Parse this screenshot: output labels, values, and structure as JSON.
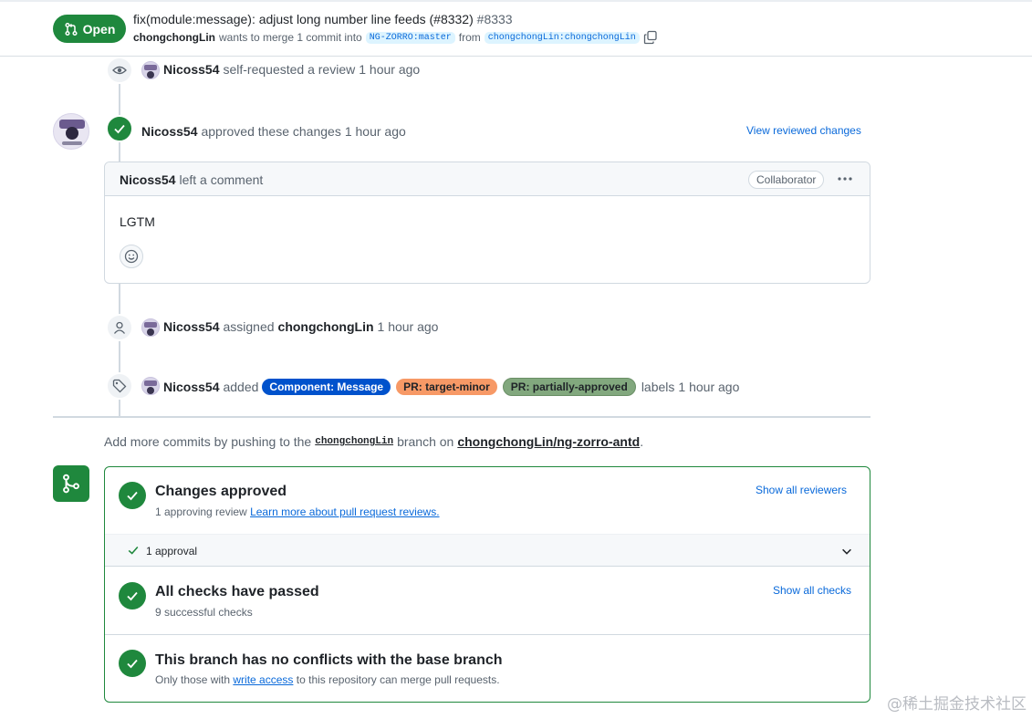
{
  "header": {
    "status": "Open",
    "title": "fix(module:message): adjust long number line feeds (#8332)",
    "number": "#8333",
    "author": "chongchongLin",
    "merge_text": "wants to merge 1 commit into",
    "base_branch": "NG-ZORRO:master",
    "from_text": "from",
    "head_branch": "chongchongLin:chongchongLin"
  },
  "timeline": {
    "event1": {
      "user": "Nicoss54",
      "text": "self-requested a review",
      "time": "1 hour ago"
    },
    "review": {
      "user": "Nicoss54",
      "text": "approved these changes",
      "time": "1 hour ago",
      "link": "View reviewed changes"
    },
    "comment": {
      "user": "Nicoss54",
      "action": "left a comment",
      "role": "Collaborator",
      "body": "LGTM"
    },
    "assign": {
      "user": "Nicoss54",
      "text": "assigned",
      "assignee": "chongchongLin",
      "time": "1 hour ago"
    },
    "labels": {
      "user": "Nicoss54",
      "text": "added",
      "items": [
        {
          "name": "Component: Message",
          "bg": "#0052cc",
          "fg": "#ffffff"
        },
        {
          "name": "PR: target-minor",
          "bg": "#f79966",
          "fg": "#1f2328"
        },
        {
          "name": "PR: partially-approved",
          "bg": "#82a87e",
          "fg": "#1f2328"
        }
      ],
      "suffix": "labels",
      "time": "1 hour ago"
    }
  },
  "push_hint": {
    "prefix": "Add more commits by pushing to the",
    "branch": "chongchongLin",
    "middle": "branch on",
    "repo": "chongchongLin/ng-zorro-antd",
    "end": "."
  },
  "merge": {
    "approved_title": "Changes approved",
    "approved_sub": "1 approving review",
    "learn_link": "Learn more about pull request reviews.",
    "show_reviewers": "Show all reviewers",
    "approval_count": "1 approval",
    "checks_title": "All checks have passed",
    "checks_sub": "9 successful checks",
    "show_checks": "Show all checks",
    "conflict_title": "This branch has no conflicts with the base branch",
    "conflict_sub_prefix": "Only those with",
    "conflict_link": "write access",
    "conflict_sub_suffix": "to this repository can merge pull requests."
  },
  "watermark": "@稀土掘金技术社区",
  "colors": {
    "green": "#1f883d",
    "link": "#0969da",
    "muted": "#59636e",
    "border": "#d1d9e0"
  }
}
